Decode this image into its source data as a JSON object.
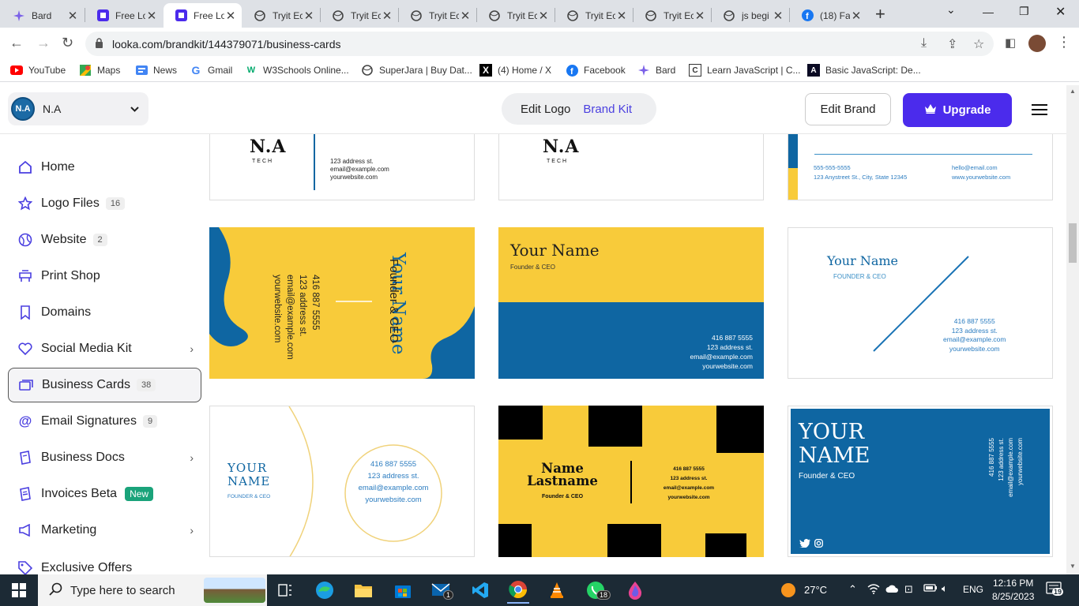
{
  "browser": {
    "tabs": [
      {
        "title": "Bard",
        "icon": "bard-icon",
        "active": false
      },
      {
        "title": "Free Lo",
        "icon": "looka-icon",
        "active": false
      },
      {
        "title": "Free Lo",
        "icon": "looka-icon",
        "active": true
      },
      {
        "title": "Tryit Ec",
        "icon": "globe-icon",
        "active": false
      },
      {
        "title": "Tryit Ec",
        "icon": "globe-icon",
        "active": false
      },
      {
        "title": "Tryit Ec",
        "icon": "globe-icon",
        "active": false
      },
      {
        "title": "Tryit Ec",
        "icon": "globe-icon",
        "active": false
      },
      {
        "title": "Tryit Ec",
        "icon": "globe-icon",
        "active": false
      },
      {
        "title": "Tryit Ec",
        "icon": "globe-icon",
        "active": false
      },
      {
        "title": "js begi",
        "icon": "globe-icon",
        "active": false
      },
      {
        "title": "(18) Fa",
        "icon": "facebook-icon",
        "active": false
      }
    ],
    "url": "looka.com/brandkit/144379071/business-cards",
    "bookmarks": [
      {
        "label": "YouTube",
        "icon": "youtube-icon"
      },
      {
        "label": "Maps",
        "icon": "maps-icon"
      },
      {
        "label": "News",
        "icon": "news-icon"
      },
      {
        "label": "Gmail",
        "icon": "google-icon"
      },
      {
        "label": "W3Schools Online...",
        "icon": "w3schools-icon"
      },
      {
        "label": "SuperJara | Buy Dat...",
        "icon": "globe-icon"
      },
      {
        "label": "(4) Home / X",
        "icon": "x-icon"
      },
      {
        "label": "Facebook",
        "icon": "facebook-icon"
      },
      {
        "label": "Bard",
        "icon": "bard-icon"
      },
      {
        "label": "Learn JavaScript | C...",
        "icon": "codecademy-icon"
      },
      {
        "label": "Basic JavaScript: De...",
        "icon": "freecodecamp-icon"
      }
    ]
  },
  "header": {
    "brand_initials": "N.A",
    "brand_name": "N.A",
    "edit_logo": "Edit Logo",
    "brand_kit": "Brand Kit",
    "edit_brand": "Edit Brand",
    "upgrade": "Upgrade"
  },
  "sidebar": {
    "items": [
      {
        "label": "Home",
        "icon": "home-icon",
        "count": "",
        "chevron": false
      },
      {
        "label": "Logo Files",
        "icon": "star-icon",
        "count": "16",
        "chevron": false
      },
      {
        "label": "Website",
        "icon": "website-icon",
        "count": "2",
        "chevron": false
      },
      {
        "label": "Print Shop",
        "icon": "print-shop-icon",
        "count": "",
        "chevron": false
      },
      {
        "label": "Domains",
        "icon": "bookmark-icon",
        "count": "",
        "chevron": false
      },
      {
        "label": "Social Media Kit",
        "icon": "heart-icon",
        "count": "",
        "chevron": true
      },
      {
        "label": "Business Cards",
        "icon": "cards-icon",
        "count": "38",
        "chevron": false,
        "active": true
      },
      {
        "label": "Email Signatures",
        "icon": "at-icon",
        "count": "9",
        "chevron": false
      },
      {
        "label": "Business Docs",
        "icon": "docs-icon",
        "count": "",
        "chevron": true
      },
      {
        "label": "Invoices Beta",
        "icon": "invoice-icon",
        "count": "",
        "badge": "New",
        "chevron": false
      },
      {
        "label": "Marketing",
        "icon": "megaphone-icon",
        "count": "",
        "chevron": true
      },
      {
        "label": "Exclusive Offers",
        "icon": "tag-icon",
        "count": "",
        "chevron": false
      }
    ]
  },
  "cards": {
    "r0c0": {
      "logo_text": "TECH",
      "addr": "123 address st.",
      "email": "email@example.com",
      "web": "yourwebsite.com"
    },
    "r0c1": {
      "logo_text": "TECH"
    },
    "r0c2": {
      "phone": "555-555-5555",
      "addr": "123 Anystreet St., City, State 12345",
      "email": "hello@email.com",
      "web": "www.yourwebsite.com"
    },
    "r1c0": {
      "name": "Your Name",
      "title": "Founder & CEO",
      "phone": "416 887 5555",
      "addr": "123 address st.",
      "email": "email@example.com",
      "web": "yourwebsite.com"
    },
    "r1c1": {
      "name": "Your Name",
      "title": "Founder & CEO",
      "phone": "416 887 5555",
      "addr": "123 address st.",
      "email": "email@example.com",
      "web": "yourwebsite.com"
    },
    "r1c2": {
      "name": "Your Name",
      "title": "FOUNDER & CEO",
      "phone": "416 887 5555",
      "addr": "123 address st.",
      "email": "email@example.com",
      "web": "yourwebsite.com"
    },
    "r2c0": {
      "name1": "YOUR",
      "name2": "NAME",
      "title": "FOUNDER & CEO",
      "phone": "416 887 5555",
      "addr": "123 address st.",
      "email": "email@example.com",
      "web": "yourwebsite.com"
    },
    "r2c1": {
      "name1": "Name",
      "name2": "Lastname",
      "title": "Founder & CEO",
      "phone": "416 887 5555",
      "addr": "123 address st.",
      "email": "email@example.com",
      "web": "yourwebsite.com"
    },
    "r2c2": {
      "name1": "YOUR",
      "name2": "NAME",
      "title": "Founder & CEO",
      "phone": "416 887 5555",
      "addr": "123 address st.",
      "email": "email@example.com",
      "web": "yourwebsite.com"
    }
  },
  "taskbar": {
    "search_placeholder": "Type here to search",
    "weather": "27°C",
    "lang": "ENG",
    "time": "12:16 PM",
    "date": "8/25/2023",
    "mail_badge": "1",
    "whatsapp_badge": "18",
    "notif_count": "19"
  },
  "colors": {
    "yellow": "#f8cb3a",
    "blue": "#0f66a2",
    "purple": "#4b2bec"
  }
}
